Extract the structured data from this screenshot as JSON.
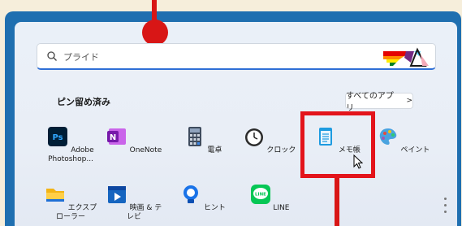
{
  "search": {
    "placeholder": "プライド"
  },
  "pinned": {
    "title": "ピン留め済み",
    "all_apps_label": "すべてのアプリ",
    "all_apps_chevron": ">"
  },
  "apps": [
    {
      "label": "Adobe Photoshop...",
      "icon": "photoshop-icon",
      "color": "#001e36"
    },
    {
      "label": "OneNote",
      "icon": "onenote-icon",
      "color": "#7719aa"
    },
    {
      "label": "電卓",
      "icon": "calculator-icon",
      "color": "#3f4c5e"
    },
    {
      "label": "クロック",
      "icon": "clock-icon",
      "color": "#2b2b2b"
    },
    {
      "label": "メモ帳",
      "icon": "notepad-icon",
      "color": "#1e9be0"
    },
    {
      "label": "ペイント",
      "icon": "paint-icon",
      "color": "#e74c3c"
    },
    {
      "label": "エクスプローラー",
      "icon": "explorer-icon",
      "color": "#f2b416"
    },
    {
      "label": "映画 & テレビ",
      "icon": "movies-icon",
      "color": "#1565c0"
    },
    {
      "label": "ヒント",
      "icon": "tips-icon",
      "color": "#1a73e8"
    },
    {
      "label": "LINE",
      "icon": "line-icon",
      "color": "#06c755"
    }
  ],
  "colors": {
    "accent": "#2f6fd6",
    "callout": "#e3141b",
    "frame": "#1f6fb0"
  }
}
